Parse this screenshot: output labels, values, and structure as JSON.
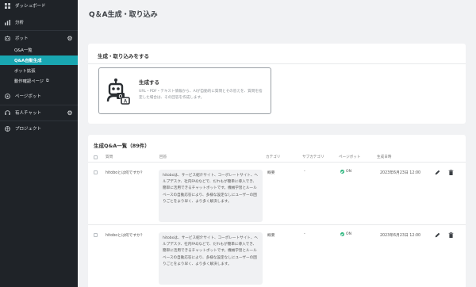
{
  "sidebar": {
    "items": [
      {
        "label": "ダッシュボード",
        "icon": "dashboard-icon"
      },
      {
        "label": "分析",
        "icon": "chart-icon"
      },
      {
        "label": "ボット",
        "icon": "bot-icon"
      },
      {
        "label": "ページボット",
        "icon": "page-bot-icon"
      },
      {
        "label": "有人チャット",
        "icon": "headset-icon"
      },
      {
        "label": "プロジェクト",
        "icon": "project-icon"
      }
    ],
    "bot_sub": [
      {
        "label": "Q&A一覧"
      },
      {
        "label": "Q&A自動生成"
      },
      {
        "label": "ボット拡張"
      },
      {
        "label": "動作確認ページ"
      }
    ]
  },
  "page": {
    "title": "Q＆A生成・取り込み"
  },
  "generate_card": {
    "title": "生成・取り込みをする",
    "option_title": "生成する",
    "option_desc": "URL・PDF・テキスト情報から、AIが自動的に質問とその答えを、質問を指定した場合は、その回答を作成します。"
  },
  "list": {
    "title": "生成Q&A一覧（89件）",
    "columns": {
      "question": "質問",
      "answer": "回答",
      "category": "カテゴリ",
      "subcategory": "サブカテゴリ",
      "pagebot": "ページボット",
      "created": "生成日時"
    },
    "rows": [
      {
        "question": "hitoboとは何ですか？",
        "answer": "hitoboは、サービス紹介サイト、コーポレートサイト、ヘルプデスク、社内FAQなどで、だれもが簡単に導入でき、簡単に活用できるチャットボットです。機械学習とルールベースの自動応答により、多様な設定なしにユーザーの困りごとをより早く、より多く解決します。",
        "category": "概要",
        "subcategory": "-",
        "pagebot": "ON",
        "created": "2023年6月23日 12:00"
      },
      {
        "question": "hitoboとは何ですか？",
        "answer": "hitoboは、サービス紹介サイト、コーポレートサイト、ヘルプデスク、社内FAQなどで、だれもが簡単に導入でき、簡単に活用できるチャットボットです。機械学習とルールベースの自動応答により、多様な設定なしにユーザーの困りごとをより早く、より多く解決します。",
        "category": "概要",
        "subcategory": "-",
        "pagebot": "ON",
        "created": "2023年6月23日 12:00"
      }
    ]
  },
  "colors": {
    "sidebar_bg": "#1f2328",
    "accent": "#19a6b1",
    "status_on": "#26b47a"
  }
}
